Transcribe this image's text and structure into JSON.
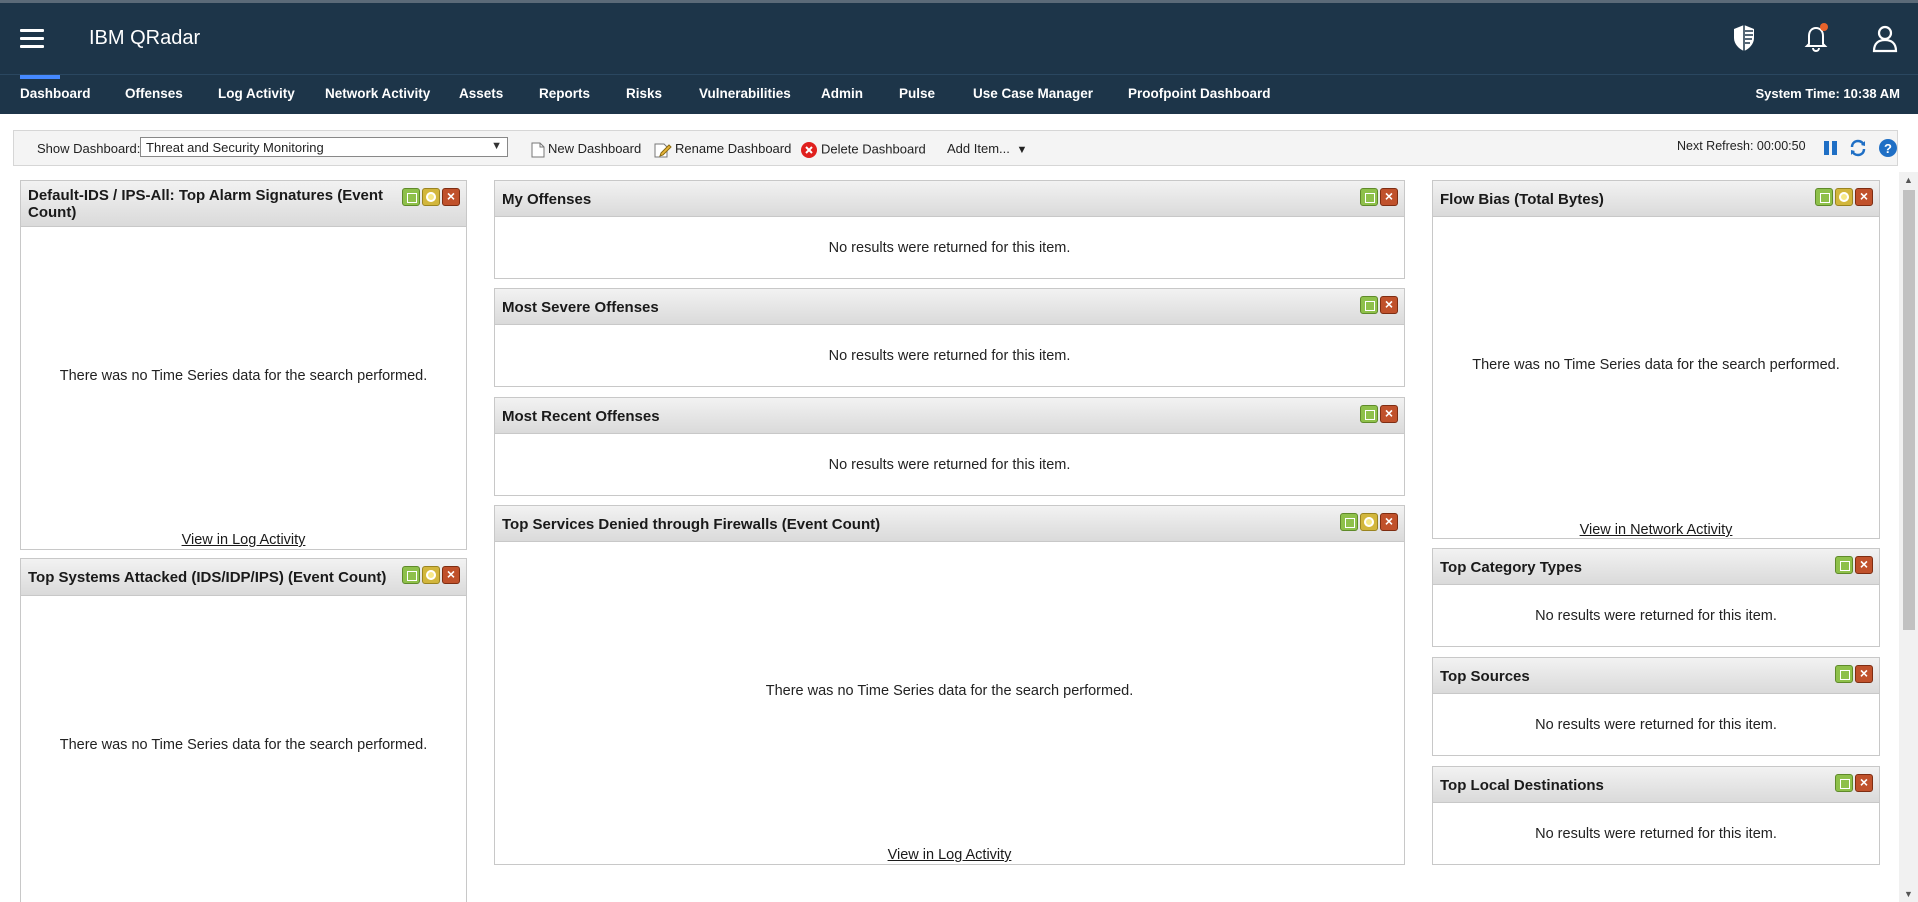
{
  "header": {
    "app_title": "IBM QRadar",
    "icons": [
      "menu-icon",
      "shield-icon",
      "notification-bell-icon",
      "user-icon"
    ],
    "notification_dot_color": "#e8632b"
  },
  "nav": {
    "items": [
      "Dashboard",
      "Offenses",
      "Log Activity",
      "Network Activity",
      "Assets",
      "Reports",
      "Risks",
      "Vulnerabilities",
      "Admin",
      "Pulse",
      "Use Case Manager",
      "Proofpoint Dashboard"
    ],
    "active": "Dashboard",
    "system_time": "System Time: 10:38 AM"
  },
  "toolbar": {
    "show_dashboard_label": "Show Dashboard:",
    "selected_dashboard": "Threat and Security Monitoring",
    "new_dashboard": "New Dashboard",
    "rename_dashboard": "Rename Dashboard",
    "delete_dashboard": "Delete Dashboard",
    "add_item": "Add Item...",
    "next_refresh": "Next Refresh: 00:00:50",
    "icons": [
      "pause-icon",
      "refresh-icon",
      "help-icon"
    ]
  },
  "widgets": {
    "alarm_signatures": {
      "title": "Default-IDS / IPS-All: Top Alarm Signatures (Event Count)",
      "message": "There was no Time Series data for the search performed.",
      "link": "View in Log Activity"
    },
    "systems_attacked": {
      "title": "Top Systems Attacked (IDS/IDP/IPS) (Event Count)",
      "message": "There was no Time Series data for the search performed."
    },
    "my_offenses": {
      "title": "My Offenses",
      "message": "No results were returned for this item."
    },
    "most_severe": {
      "title": "Most Severe Offenses",
      "message": "No results were returned for this item."
    },
    "most_recent": {
      "title": "Most Recent Offenses",
      "message": "No results were returned for this item."
    },
    "services_denied": {
      "title": "Top Services Denied through Firewalls (Event Count)",
      "message": "There was no Time Series data for the search performed.",
      "link": "View in Log Activity"
    },
    "flow_bias": {
      "title": "Flow Bias (Total Bytes)",
      "message": "There was no Time Series data for the search performed.",
      "link": "View in Network Activity"
    },
    "category_types": {
      "title": "Top Category Types",
      "message": "No results were returned for this item."
    },
    "top_sources": {
      "title": "Top Sources",
      "message": "No results were returned for this item."
    },
    "local_destinations": {
      "title": "Top Local Destinations",
      "message": "No results were returned for this item."
    }
  }
}
